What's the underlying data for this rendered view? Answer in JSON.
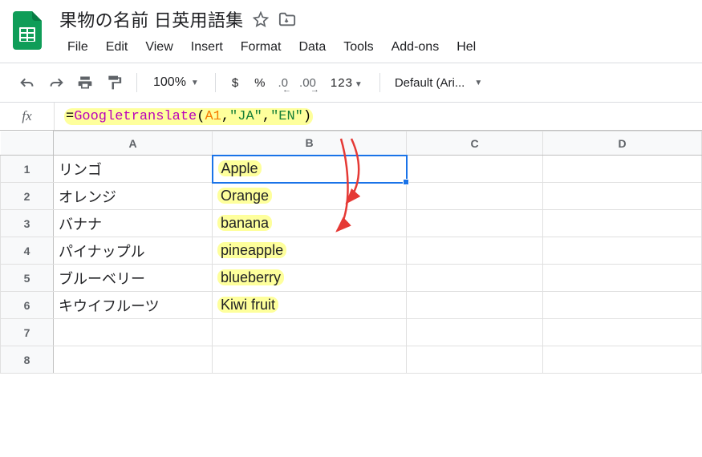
{
  "header": {
    "title": "果物の名前 日英用語集"
  },
  "menu": {
    "items": [
      "File",
      "Edit",
      "View",
      "Insert",
      "Format",
      "Data",
      "Tools",
      "Add-ons",
      "Hel"
    ]
  },
  "toolbar": {
    "zoom": "100%",
    "currency": "$",
    "percent": "%",
    "dec_dec": ".0",
    "inc_dec": ".00",
    "num123": "123",
    "font": "Default (Ari..."
  },
  "formula": {
    "fx": "fx",
    "prefix": "=",
    "fn": "Googletranslate",
    "open": "(",
    "arg1": "A1",
    "comma1": ",",
    "arg2": "\"JA\"",
    "comma2": ",",
    "arg3": "\"EN\"",
    "close": ")"
  },
  "columns": [
    "A",
    "B",
    "C",
    "D"
  ],
  "rows": [
    "1",
    "2",
    "3",
    "4",
    "5",
    "6",
    "7",
    "8"
  ],
  "cells": {
    "a": [
      "リンゴ",
      "オレンジ",
      "バナナ",
      "パイナップル",
      "ブルーベリー",
      "キウイフルーツ",
      "",
      ""
    ],
    "b": [
      "Apple",
      "Orange",
      "banana",
      "pineapple",
      "blueberry",
      "Kiwi fruit",
      "",
      ""
    ]
  }
}
